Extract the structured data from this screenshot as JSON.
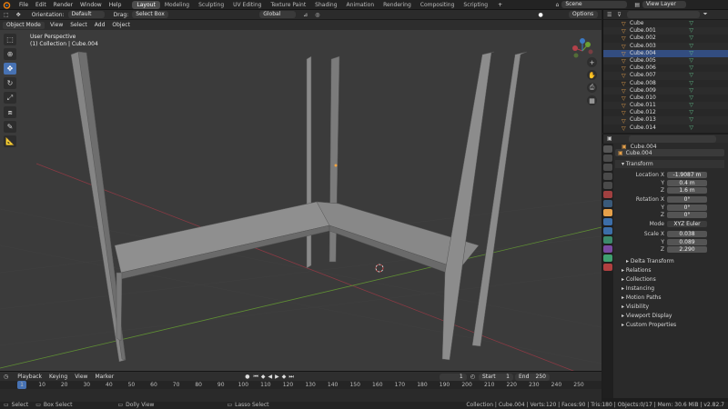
{
  "menubar": {
    "menus": [
      "File",
      "Edit",
      "Render",
      "Window",
      "Help"
    ],
    "workspaces": [
      "Layout",
      "Modeling",
      "Sculpting",
      "UV Editing",
      "Texture Paint",
      "Shading",
      "Animation",
      "Rendering",
      "Compositing",
      "Scripting"
    ],
    "active_workspace": "Layout",
    "add_tab": "+",
    "scene": "Scene",
    "view_layer": "View Layer"
  },
  "toolheader": {
    "orientation_label": "Orientation:",
    "orientation_value": "Default",
    "drag_label": "Drag:",
    "drag_value": "Select Box",
    "transform_orientation": "Global",
    "options": "Options"
  },
  "viewheader": {
    "mode": "Object Mode",
    "menus": [
      "View",
      "Select",
      "Add",
      "Object"
    ]
  },
  "viewport": {
    "perspective": "User Perspective",
    "collection": "(1) Collection | Cube.004"
  },
  "outliner": {
    "items": [
      "Cube",
      "Cube.001",
      "Cube.002",
      "Cube.003",
      "Cube.004",
      "Cube.005",
      "Cube.006",
      "Cube.007",
      "Cube.008",
      "Cube.009",
      "Cube.010",
      "Cube.011",
      "Cube.012",
      "Cube.013",
      "Cube.014"
    ],
    "selected": "Cube.004"
  },
  "properties": {
    "object_name": "Cube.004",
    "object_data": "Cube.004",
    "transform_title": "Transform",
    "location_label": "Location X",
    "location": [
      "-1.9087 m",
      "0.4 m",
      "1.6 m"
    ],
    "rotation_label": "Rotation X",
    "rotation": [
      "0°",
      "0°",
      "0°"
    ],
    "mode_label": "Mode",
    "mode_value": "XYZ Euler",
    "scale_label": "Scale X",
    "scale": [
      "0.038",
      "0.089",
      "2.290"
    ],
    "axis_y": "Y",
    "axis_z": "Z",
    "delta_transform": "Delta Transform",
    "sections": [
      "Relations",
      "Collections",
      "Instancing",
      "Motion Paths",
      "Visibility",
      "Viewport Display",
      "Custom Properties"
    ]
  },
  "timeline": {
    "menus": [
      "Playback",
      "Keying",
      "View",
      "Marker"
    ],
    "current_frame": "1",
    "start_label": "Start",
    "start": "1",
    "end_label": "End",
    "end": "250",
    "ruler": [
      "1",
      "10",
      "20",
      "30",
      "40",
      "50",
      "60",
      "70",
      "80",
      "90",
      "100",
      "110",
      "120",
      "130",
      "140",
      "150",
      "160",
      "170",
      "180",
      "190",
      "200",
      "210",
      "220",
      "230",
      "240",
      "250"
    ]
  },
  "statusbar": {
    "select": "Select",
    "box_select": "Box Select",
    "dolly_view": "Dolly View",
    "lasso_select": "Lasso Select",
    "stats": "Collection | Cube.004 | Verts:120 | Faces:90 | Tris:180 | Objects:0/17 | Mem: 30.6 MiB | v2.82.7"
  },
  "colors": {
    "accent": "#4772b3",
    "selection_outline": "#e5a04a",
    "viewport_bg": "#3b3b3b",
    "x_axis": "#9b3b47",
    "y_axis": "#6b9b36"
  }
}
